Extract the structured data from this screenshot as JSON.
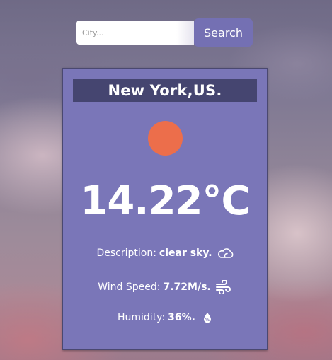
{
  "search": {
    "placeholder": "City...",
    "value": "",
    "button_label": "Search"
  },
  "weather": {
    "location": "New York,US.",
    "temperature": "14.22°C",
    "description_label": "Description:",
    "description_value": "clear sky.",
    "wind_label": "Wind Speed:",
    "wind_value": "7.72M/s.",
    "humidity_label": "Humidity:",
    "humidity_value": "36%."
  },
  "icons": {
    "condition": "sun-icon",
    "description": "cloud-icon",
    "wind": "wind-icon",
    "humidity": "water-drop-icon"
  },
  "colors": {
    "card": "#7a76b8",
    "header": "#454570",
    "button": "#7470b3",
    "sun": "#ec6e4b",
    "text": "#ffffff"
  }
}
